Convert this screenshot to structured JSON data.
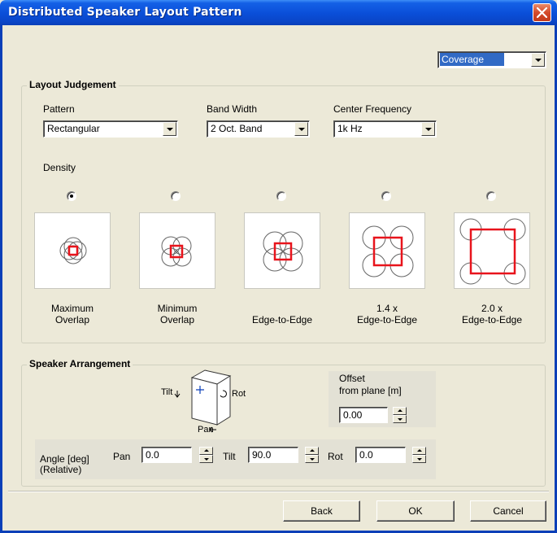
{
  "window": {
    "title": "Distributed Speaker Layout Pattern"
  },
  "view_select": {
    "value": "Coverage"
  },
  "layout_judgement": {
    "title": "Layout Judgement",
    "pattern": {
      "label": "Pattern",
      "value": "Rectangular"
    },
    "bandwidth": {
      "label": "Band Width",
      "value": "2 Oct. Band"
    },
    "center_freq": {
      "label": "Center Frequency",
      "value": "1k Hz"
    },
    "density": {
      "label": "Density",
      "options": [
        {
          "line1": "Maximum",
          "line2": "Overlap",
          "selected": true
        },
        {
          "line1": "Minimum",
          "line2": "Overlap",
          "selected": false
        },
        {
          "line1": "",
          "line2": "Edge-to-Edge",
          "selected": false
        },
        {
          "line1": "1.4 x",
          "line2": "Edge-to-Edge",
          "selected": false
        },
        {
          "line1": "2.0 x",
          "line2": "Edge-to-Edge",
          "selected": false
        }
      ]
    }
  },
  "speaker_arrangement": {
    "title": "Speaker Arrangement",
    "diagram": {
      "tilt": "Tilt",
      "rot": "Rot",
      "pan": "Pan"
    },
    "offset": {
      "line1": "Offset",
      "line2": "from plane [m]",
      "value": "0.00"
    },
    "angle": {
      "label1": "Angle [deg]",
      "label2": "(Relative)",
      "pan_label": "Pan",
      "pan_value": "0.0",
      "tilt_label": "Tilt",
      "tilt_value": "90.0",
      "rot_label": "Rot",
      "rot_value": "0.0"
    }
  },
  "buttons": {
    "back": "Back",
    "ok": "OK",
    "cancel": "Cancel"
  },
  "colors": {
    "accent_square": "#e8141c",
    "title_bar": "#0a4ed8",
    "selection": "#316ac5"
  }
}
